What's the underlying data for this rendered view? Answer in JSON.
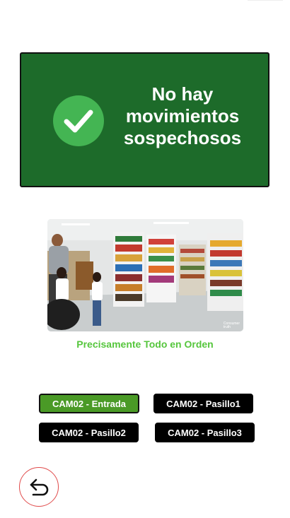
{
  "status": {
    "message": "No hay\nmovimientos\nsospechosos",
    "icon": "check-icon",
    "card_color": "#1d6b2a",
    "icon_color": "#44b553"
  },
  "camera_feed": {
    "image": "store-aisle-camera-image",
    "watermark": "Consumer\ntruth"
  },
  "caption": "Precisamente Todo en Orden",
  "cameras": {
    "entrada": "CAM02 - Entrada",
    "pasillo1": "CAM02 - Pasillo1",
    "pasillo2": "CAM02 - Pasillo2",
    "pasillo3": "CAM02 - Pasillo3",
    "selected": "CAM02 - Entrada",
    "active_color": "#4a9a26"
  },
  "back": {
    "icon": "undo-arrow-icon"
  }
}
